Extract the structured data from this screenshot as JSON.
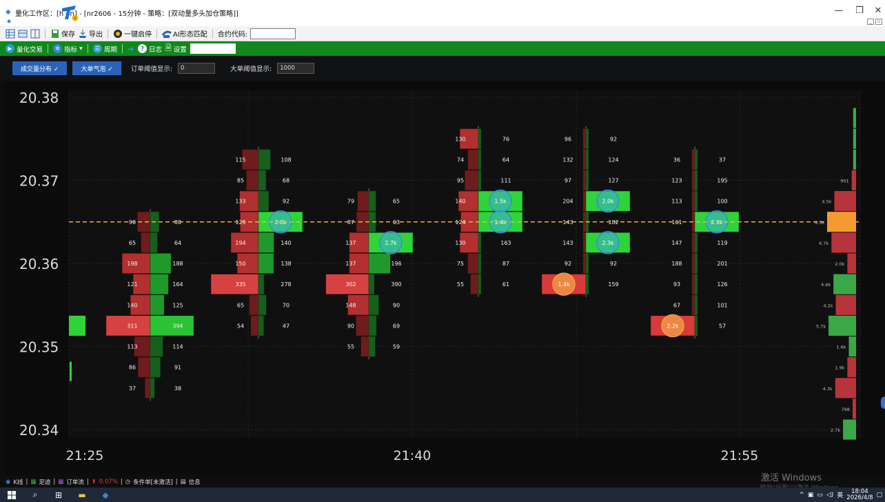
{
  "window": {
    "title": "量化工作区：[h          on] - [nr2606 - 15分钟 - 策略：[双动量多头加仓策略]]",
    "controls": {
      "minimize": "—",
      "restore": "❐",
      "close": "✕"
    }
  },
  "toolbar": {
    "save": "保存",
    "export": "导出",
    "one_click": "一键启停",
    "ai_pattern": "AI形态匹配",
    "contract_code_label": "合约代码:"
  },
  "greenbar": {
    "quant_trade": "量化交易",
    "indicator": "指标",
    "period": "周期",
    "log": "日志",
    "settings": "设置"
  },
  "controls": {
    "volume_dist": "成交量分布 ✓",
    "big_bubble": "大单气泡 ✓",
    "order_threshold_label": "订单阈值显示:",
    "order_threshold_value": "0",
    "big_threshold_label": "大单阈值显示:",
    "big_threshold_value": "1000"
  },
  "chart_data": {
    "type": "footprint",
    "y_ticks": [
      "20.38",
      "20.37",
      "20.36",
      "20.35",
      "20.34"
    ],
    "x_ticks": [
      "21:25",
      "21:40",
      "21:55"
    ],
    "current_price_line": 20.365,
    "bars": [
      {
        "rows": [
          {
            "p": 20.365,
            "bid": "90",
            "ask": "80",
            "b": 90,
            "a": 80
          },
          {
            "p": 20.3625,
            "bid": "65",
            "ask": "64",
            "b": 65,
            "a": 64
          },
          {
            "p": 20.36,
            "bid": "198",
            "ask": "188",
            "b": 198,
            "a": 188
          },
          {
            "p": 20.3575,
            "bid": "121",
            "ask": "164",
            "b": 121,
            "a": 164
          },
          {
            "p": 20.355,
            "bid": "140",
            "ask": "125",
            "b": 140,
            "a": 125
          },
          {
            "p": 20.3525,
            "bid": "311",
            "ask": "394",
            "b": 311,
            "a": 394
          },
          {
            "p": 20.35,
            "bid": "113",
            "ask": "114",
            "b": 113,
            "a": 114
          },
          {
            "p": 20.3475,
            "bid": "86",
            "ask": "91",
            "b": 86,
            "a": 91
          },
          {
            "p": 20.345,
            "bid": "37",
            "ask": "38",
            "b": 37,
            "a": 38
          }
        ]
      },
      {
        "rows": [
          {
            "p": 20.3725,
            "bid": "115",
            "ask": "108",
            "b": 115,
            "a": 108
          },
          {
            "p": 20.37,
            "bid": "85",
            "ask": "68",
            "b": 85,
            "a": 68
          },
          {
            "p": 20.3675,
            "bid": "133",
            "ask": "92",
            "b": 133,
            "a": 92
          },
          {
            "p": 20.365,
            "bid": "129",
            "ask": "",
            "b": 129,
            "a": 620
          },
          {
            "p": 20.3625,
            "bid": "194",
            "ask": "140",
            "b": 194,
            "a": 140
          },
          {
            "p": 20.36,
            "bid": "150",
            "ask": "138",
            "b": 150,
            "a": 138
          },
          {
            "p": 20.3575,
            "bid": "335",
            "ask": "278",
            "b": 335,
            "a": 50
          },
          {
            "p": 20.355,
            "bid": "65",
            "ask": "70",
            "b": 65,
            "a": 70
          },
          {
            "p": 20.3525,
            "bid": "54",
            "ask": "47",
            "b": 54,
            "a": 47
          }
        ],
        "bubble": {
          "p": 20.365,
          "label": "2.0k",
          "side": "ask"
        }
      },
      {
        "rows": [
          {
            "p": 20.3675,
            "bid": "79",
            "ask": "65",
            "b": 79,
            "a": 65
          },
          {
            "p": 20.365,
            "bid": "87",
            "ask": "63",
            "b": 87,
            "a": 63
          },
          {
            "p": 20.3625,
            "bid": "137",
            "ask": "",
            "b": 137,
            "a": 620
          },
          {
            "p": 20.36,
            "bid": "137",
            "ask": "196",
            "b": 137,
            "a": 196
          },
          {
            "p": 20.3575,
            "bid": "302",
            "ask": "390",
            "b": 302,
            "a": 50
          },
          {
            "p": 20.355,
            "bid": "148",
            "ask": "90",
            "b": 148,
            "a": 90
          },
          {
            "p": 20.3525,
            "bid": "90",
            "ask": "69",
            "b": 90,
            "a": 69
          },
          {
            "p": 20.35,
            "bid": "55",
            "ask": "59",
            "b": 55,
            "a": 59
          }
        ],
        "bubble": {
          "p": 20.3625,
          "label": "2.7k",
          "side": "ask"
        }
      },
      {
        "rows": [
          {
            "p": 20.375,
            "bid": "130",
            "ask": "76",
            "b": 130,
            "a": 20
          },
          {
            "p": 20.3725,
            "bid": "74",
            "ask": "64",
            "b": 74,
            "a": 20
          },
          {
            "p": 20.37,
            "bid": "95",
            "ask": "111",
            "b": 95,
            "a": 20
          },
          {
            "p": 20.3675,
            "bid": "140",
            "ask": "",
            "b": 140,
            "a": 620
          },
          {
            "p": 20.365,
            "bid": "124",
            "ask": "",
            "b": 124,
            "a": 620
          },
          {
            "p": 20.3625,
            "bid": "130",
            "ask": "163",
            "b": 130,
            "a": 20
          },
          {
            "p": 20.36,
            "bid": "75",
            "ask": "87",
            "b": 75,
            "a": 20
          },
          {
            "p": 20.3575,
            "bid": "55",
            "ask": "61",
            "b": 55,
            "a": 20
          }
        ],
        "bubbles": [
          {
            "p": 20.3675,
            "label": "1.5k",
            "side": "ask"
          },
          {
            "p": 20.365,
            "label": "1.4k",
            "side": "ask"
          }
        ]
      },
      {
        "rows": [
          {
            "p": 20.375,
            "bid": "96",
            "ask": "92",
            "b": 20,
            "a": 20
          },
          {
            "p": 20.3725,
            "bid": "132",
            "ask": "124",
            "b": 20,
            "a": 20
          },
          {
            "p": 20.37,
            "bid": "97",
            "ask": "127",
            "b": 20,
            "a": 20
          },
          {
            "p": 20.3675,
            "bid": "204",
            "ask": "",
            "b": 20,
            "a": 620
          },
          {
            "p": 20.365,
            "bid": "143",
            "ask": "182",
            "b": 20,
            "a": 20
          },
          {
            "p": 20.3625,
            "bid": "143",
            "ask": "",
            "b": 20,
            "a": 620
          },
          {
            "p": 20.36,
            "bid": "92",
            "ask": "92",
            "b": 20,
            "a": 20
          },
          {
            "p": 20.3575,
            "bid": "",
            "ask": "159",
            "b": 620,
            "a": 20
          }
        ],
        "bubbles": [
          {
            "p": 20.3675,
            "label": "2.0k",
            "side": "ask"
          },
          {
            "p": 20.3625,
            "label": "2.3k",
            "side": "ask"
          },
          {
            "p": 20.3575,
            "label": "1.4k",
            "side": "bid"
          }
        ]
      },
      {
        "rows": [
          {
            "p": 20.3725,
            "bid": "36",
            "ask": "37",
            "b": 20,
            "a": 20
          },
          {
            "p": 20.37,
            "bid": "123",
            "ask": "195",
            "b": 20,
            "a": 20
          },
          {
            "p": 20.3675,
            "bid": "113",
            "ask": "100",
            "b": 20,
            "a": 20
          },
          {
            "p": 20.365,
            "bid": "161",
            "ask": "",
            "b": 20,
            "a": 620
          },
          {
            "p": 20.3625,
            "bid": "147",
            "ask": "119",
            "b": 20,
            "a": 20
          },
          {
            "p": 20.36,
            "bid": "188",
            "ask": "201",
            "b": 20,
            "a": 20
          },
          {
            "p": 20.3575,
            "bid": "93",
            "ask": "126",
            "b": 20,
            "a": 20
          },
          {
            "p": 20.355,
            "bid": "67",
            "ask": "101",
            "b": 20,
            "a": 20
          },
          {
            "p": 20.3525,
            "bid": "",
            "ask": "57",
            "b": 620,
            "a": 20
          }
        ],
        "bubbles": [
          {
            "p": 20.365,
            "label": "2.9k",
            "side": "ask"
          },
          {
            "p": 20.3525,
            "label": "2.2k",
            "side": "bid"
          }
        ]
      }
    ],
    "volume_profile": [
      {
        "p": 20.3775,
        "label": "",
        "v": 0.1,
        "c": "green"
      },
      {
        "p": 20.375,
        "label": "",
        "v": 0.1,
        "c": "green"
      },
      {
        "p": 20.3725,
        "label": "",
        "v": 0.1,
        "c": "green"
      },
      {
        "p": 20.37,
        "label": "901",
        "v": 0.15,
        "c": "red"
      },
      {
        "p": 20.3675,
        "label": "4.5k",
        "v": 0.75,
        "c": "red"
      },
      {
        "p": 20.365,
        "label": "9.5k",
        "v": 1.0,
        "c": "orange"
      },
      {
        "p": 20.3625,
        "label": "6.7k",
        "v": 0.85,
        "c": "red"
      },
      {
        "p": 20.36,
        "label": "2.0k",
        "v": 0.3,
        "c": "red"
      },
      {
        "p": 20.3575,
        "label": "4.6k",
        "v": 0.78,
        "c": "green"
      },
      {
        "p": 20.355,
        "label": "4.2k",
        "v": 0.7,
        "c": "red"
      },
      {
        "p": 20.3525,
        "label": "5.7k",
        "v": 0.95,
        "c": "green"
      },
      {
        "p": 20.35,
        "label": "1.6k",
        "v": 0.25,
        "c": "green"
      },
      {
        "p": 20.3475,
        "label": "1.9k",
        "v": 0.3,
        "c": "red"
      },
      {
        "p": 20.345,
        "label": "4.3k",
        "v": 0.72,
        "c": "red"
      },
      {
        "p": 20.3425,
        "label": "798",
        "v": 0.12,
        "c": "red"
      },
      {
        "p": 20.34,
        "label": "2.7k",
        "v": 0.45,
        "c": "green"
      }
    ]
  },
  "statusbar": {
    "kline": "K线",
    "footprint": "足迹",
    "orderflow": "订单流",
    "change": "0.07%",
    "condition": "条件单[未激活]",
    "info": "信息"
  },
  "watermark": {
    "line1": "激活 Windows",
    "line2": "转到\"设置\"以激活 Windows。"
  },
  "taskbar": {
    "tray_lang": "英",
    "time": "18:04",
    "date": "2026/4/8"
  },
  "colors": {
    "ask_green": "#2fd43a",
    "bid_red": "#d93a3a",
    "accent_blue": "#2a64b8",
    "green_bar": "#10881c",
    "price_line": "#e8b83c"
  }
}
